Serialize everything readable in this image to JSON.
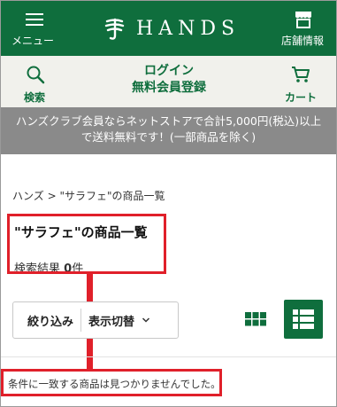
{
  "header": {
    "menu_label": "メニュー",
    "logo_text": "HANDS",
    "store_label": "店舗情報"
  },
  "subheader": {
    "search_label": "検索",
    "login_line1": "ログイン",
    "login_line2": "無料会員登録",
    "cart_label": "カート"
  },
  "banner": {
    "line1": "ハンズクラブ会員ならネットストアで合計5,000円(税込)以上",
    "line2": "で送料無料です！(一部商品を除く)"
  },
  "breadcrumb": "ハンズ > \"サラフェ\"の商品一覧",
  "page_title": "\"サラフェ\"の商品一覧",
  "result": {
    "label": "検索結果",
    "count": "0",
    "unit": "件"
  },
  "controls": {
    "filter_label": "絞り込み",
    "display_label": "表示切替"
  },
  "message": "条件に一致する商品は見つかりませんでした。",
  "colors": {
    "brand_green": "#0f6e3d",
    "annotation_red": "#e0202a",
    "banner_gray": "#8a8a8a"
  }
}
